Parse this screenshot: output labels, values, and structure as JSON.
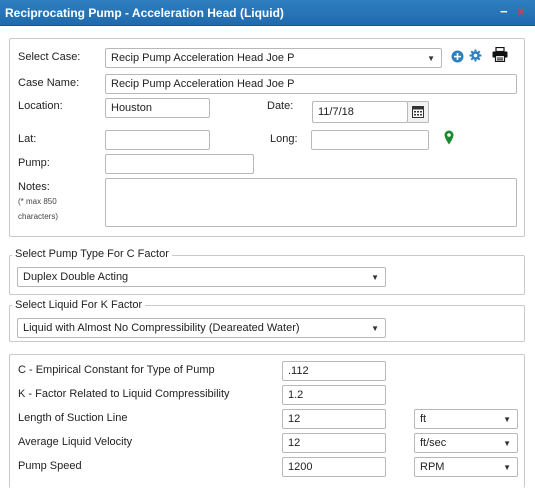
{
  "window": {
    "title": "Reciprocating Pump - Acceleration Head (Liquid)",
    "minimize_label": "−",
    "close_label": "×"
  },
  "case": {
    "select_label": "Select Case:",
    "selected_case": "Recip Pump Acceleration Head Joe P",
    "name_label": "Case Name:",
    "name_value": "Recip Pump Acceleration Head Joe P",
    "location_label": "Location:",
    "location_value": "Houston",
    "date_label": "Date:",
    "date_value": "11/7/18",
    "lat_label": "Lat:",
    "lat_value": "",
    "long_label": "Long:",
    "long_value": "",
    "pump_label": "Pump:",
    "pump_value": "",
    "notes_label": "Notes:",
    "notes_hint_1": "(* max 850",
    "notes_hint_2": "characters)",
    "notes_value": ""
  },
  "pump_type": {
    "legend": "Select Pump Type For C Factor",
    "selected": "Duplex Double Acting"
  },
  "liquid": {
    "legend": "Select Liquid For K Factor",
    "selected": "Liquid with Almost No Compressibility (Deareated Water)"
  },
  "params": {
    "c_label": "C - Empirical Constant for Type of Pump",
    "c_value": ".112",
    "k_label": "K - Factor Related to Liquid Compressibility",
    "k_value": "1.2",
    "length_label": "Length of Suction Line",
    "length_value": "12",
    "length_unit": "ft",
    "velocity_label": "Average Liquid Velocity",
    "velocity_value": "12",
    "velocity_unit": "ft/sec",
    "speed_label": "Pump Speed",
    "speed_value": "1200",
    "speed_unit": "RPM"
  },
  "icons": {
    "add": "plus-circle-icon",
    "settings": "gear-icon",
    "print": "printer-icon",
    "calendar": "calendar-icon",
    "location": "map-pin-icon"
  },
  "colors": {
    "titlebar": "#2f7fc0",
    "close": "#e53935",
    "add_icon": "#2f7fc0",
    "pin": "#1b8a2e"
  }
}
